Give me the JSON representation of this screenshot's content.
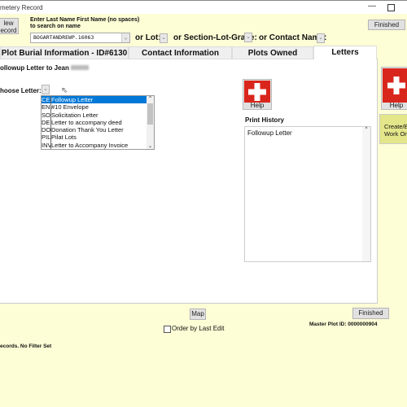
{
  "window": {
    "title": "metery Record"
  },
  "header": {
    "new_record_label_1": "lew",
    "new_record_label_2": "ecord",
    "search_hint_1": "Enter Last Name First Name (no spaces)",
    "search_hint_2": "to search on name",
    "search_value": "BOGARTANDREWP.16063",
    "or_lot": "or Lot:",
    "or_slg": "or Section-Lot-Grave:",
    "or_contact": "or Contact Name:",
    "finished": "Finished"
  },
  "tabs": [
    {
      "label": "Plot Burial Information - ID#6130"
    },
    {
      "label": "Contact Information"
    },
    {
      "label": "Plots Owned"
    },
    {
      "label": "Letters",
      "active": true
    }
  ],
  "letters": {
    "heading": "ollowup Letter to Jean",
    "choose_label": "hoose Letter:",
    "options": [
      {
        "code": "CE",
        "name": "Followup Letter",
        "selected": true
      },
      {
        "code": "EN",
        "name": "#10 Envelope"
      },
      {
        "code": "SO",
        "name": "Solicitation Letter"
      },
      {
        "code": "DE",
        "name": "Letter to accompany deed"
      },
      {
        "code": "DO",
        "name": "Donation Thank You Letter"
      },
      {
        "code": "PIL",
        "name": "Pilat Lots"
      },
      {
        "code": "INV",
        "name": "Letter to Accompany Invoice"
      }
    ],
    "help": "Help",
    "print_history_label": "Print History",
    "print_history": [
      "Followup Letter"
    ]
  },
  "side": {
    "help": "Help",
    "work_order_1": "Create/E",
    "work_order_2": "Work Ord"
  },
  "footer": {
    "map": "Map",
    "finished": "Finished",
    "order_by_last_edit": "Order by Last Edit",
    "master_plot_id": "Master Plot ID: 0000000904",
    "records": "ecords. No Filter Set"
  },
  "colors": {
    "background": "#fdfdd6",
    "selection": "#0078d7",
    "help_red": "#d9261c"
  }
}
